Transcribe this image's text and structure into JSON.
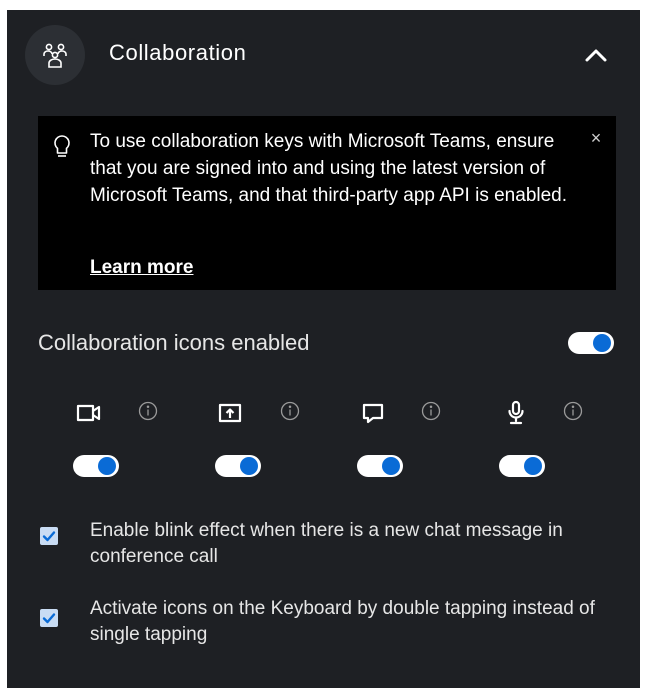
{
  "header": {
    "title": "Collaboration",
    "icon": "people-group-icon",
    "collapse_icon": "chevron-up-icon"
  },
  "notice": {
    "icon": "lightbulb-icon",
    "text": "To use collaboration keys with Microsoft Teams, ensure that you are signed into and using the latest version of Microsoft Teams, and that third-party app API is enabled.",
    "close_label": "×",
    "learn_more": "Learn more"
  },
  "collaboration_icons": {
    "label": "Collaboration icons enabled",
    "enabled": true,
    "items": [
      {
        "icon": "video-camera-icon",
        "info_icon": "info-icon",
        "enabled": true
      },
      {
        "icon": "screen-share-icon",
        "info_icon": "info-icon",
        "enabled": true
      },
      {
        "icon": "chat-icon",
        "info_icon": "info-icon",
        "enabled": true
      },
      {
        "icon": "microphone-icon",
        "info_icon": "info-icon",
        "enabled": true
      }
    ]
  },
  "options": [
    {
      "label": "Enable blink effect when there is a new chat message in conference call",
      "checked": true
    },
    {
      "label": "Activate icons on the Keyboard by double tapping instead of single tapping",
      "checked": true
    }
  ],
  "colors": {
    "panel_bg": "#1e2024",
    "notice_bg": "#000000",
    "accent": "#0a6bd6",
    "checkbox_bg": "#c9dcf4"
  }
}
